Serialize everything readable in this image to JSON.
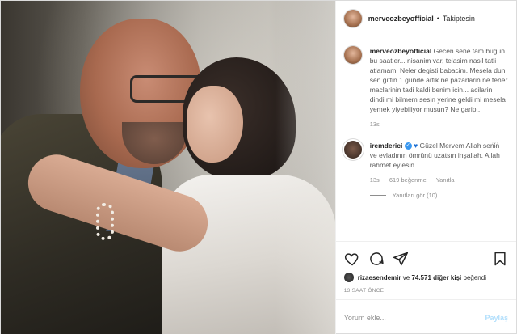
{
  "post": {
    "username": "merveozbeyofficial",
    "follow_status": "Takiptesin",
    "caption": "Gecen sene tam bugun bu saatler... nisanim var, telasim nasil tatli atlamam. Neler degisti babacim. Mesela dun sen gittin 1 gunde artik ne pazarlarin ne fener maclarinin tadi kaldi benim icin... acilarin dindi mi bilmem sesin yerine geldi mi mesela yemek yiyebiliyor musun? Ne garip...",
    "caption_age": "13s"
  },
  "comment": {
    "username": "iremderici",
    "text": "Güzel Mervem Allah senin ve evladının ömrünü uzatsın inşallah. Allah rahmet eylesin..",
    "age": "13s",
    "likes": "619 beğenme",
    "reply_label": "Yanıtla",
    "view_replies": "Yanıtları gör (10)"
  },
  "likes_line": {
    "first_liker": "rizaesendemir",
    "connector": "ve",
    "others": "74.571 diğer kişi",
    "suffix": "beğendi"
  },
  "timestamp": "13 SAAT ÖNCE",
  "add_comment": {
    "placeholder": "Yorum ekle...",
    "post_label": "Paylaş"
  },
  "icons": {
    "like": "heart-icon",
    "comment": "comment-icon",
    "share": "share-icon",
    "save": "bookmark-icon",
    "more": "more-icon"
  },
  "colors": {
    "link_blue": "#3897f0",
    "post_disabled": "#b2dffc",
    "muted": "#8e8e8e"
  }
}
